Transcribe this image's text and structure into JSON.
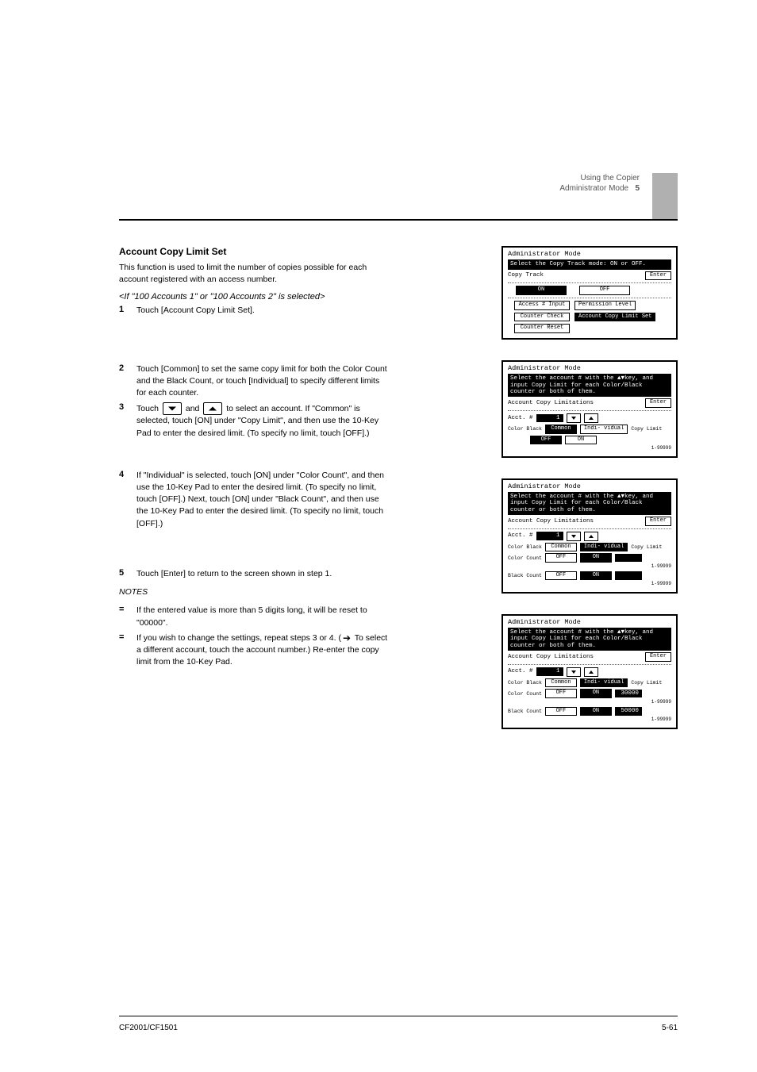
{
  "page": {
    "short_title_top": "Using the Copier",
    "short_title_bottom": "Administrator Mode",
    "section_number": "5",
    "footer_left": "CF2001/CF1501",
    "footer_right": "5-61"
  },
  "text": {
    "heading": "Account Copy Limit Set",
    "sub_if_100": "<If \"100 Accounts 1\" or \"100 Accounts 2\" is selected>",
    "lead_para": "This function is used to limit the number of copies possible for each account registered with an access number.",
    "step1": "Touch [Account Copy Limit Set].",
    "step2": "Touch [Common] to set the same copy limit for both the Color Count and the Black Count, or touch [Individual] to specify different limits for each counter.",
    "step3_pre": "Touch ",
    "step3_mid": " and ",
    "step3_post": " to select an account. If \"Common\" is selected, touch [ON] under \"Copy Limit\", and then use the 10-Key Pad to enter the desired limit. (To specify no limit, touch [OFF].)",
    "step4": "If \"Individual\" is selected, touch [ON] under \"Color Count\", and then use the 10-Key Pad to enter the desired limit. (To specify no limit, touch [OFF].) Next, touch [ON] under \"Black Count\", and then use the 10-Key Pad to enter the desired limit. (To specify no limit, touch [OFF].)",
    "step5": "Touch [Enter] to return to the screen shown in step 1.",
    "note_bullet1": "If the entered value is more than 5 digits long, it will be reset to \"00000\".",
    "note_bullet2_pre": "If you wish to change the settings, repeat steps 3 or 4. (",
    "note_bullet2_post": " To select a different account, touch the account number.) Re-enter the copy limit from the 10-Key Pad."
  },
  "panels": {
    "p1": {
      "title": "Administrator Mode",
      "bar": "Select the Copy Track mode: ON or OFF.",
      "label_copy_track": "Copy Track",
      "enter": "Enter",
      "on": "ON",
      "off": "OFF",
      "btn_access": "Access # Input",
      "btn_perm": "Permission Level",
      "btn_counter_check": "Counter Check",
      "btn_limit_set": "Account Copy Limit Set",
      "btn_counter_reset": "Counter Reset"
    },
    "p2": {
      "title": "Administrator Mode",
      "bar": "Select the account # with the ▲▼key, and input Copy Limit for each Color/Black counter or both of them.",
      "header": "Account Copy Limitations",
      "enter": "Enter",
      "acct": "Acct. #",
      "acct_val": "1",
      "color_black": "Color Black",
      "common": "Common",
      "individual": "Indi- vidual",
      "copy_limit": "Copy Limit",
      "off": "OFF",
      "on": "ON",
      "range": "1-99999"
    },
    "p3": {
      "color_count": "Color Count",
      "black_count": "Black Count",
      "color_val": "30000",
      "black_val": "50000"
    }
  }
}
